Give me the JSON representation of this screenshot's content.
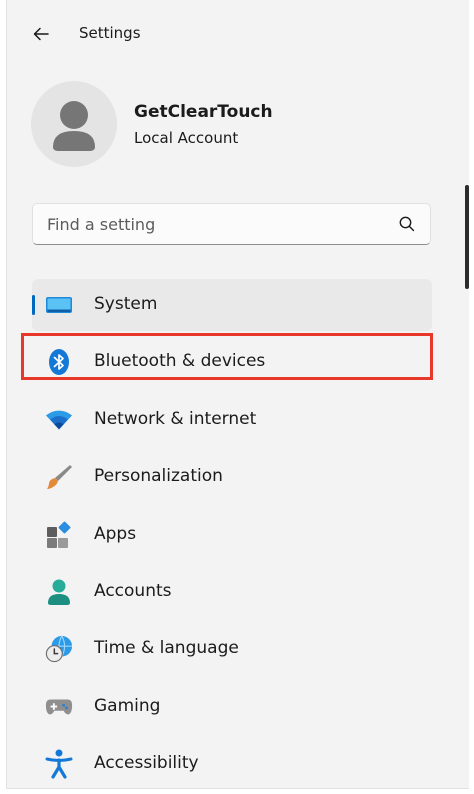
{
  "header": {
    "title": "Settings",
    "back_icon": "back-arrow-icon"
  },
  "profile": {
    "name": "GetClearTouch",
    "account_type": "Local Account",
    "avatar_icon": "user-avatar-icon"
  },
  "search": {
    "placeholder": "Find a setting",
    "value": "",
    "icon": "search-icon"
  },
  "nav": {
    "items": [
      {
        "label": "System",
        "icon": "monitor-icon",
        "selected": true
      },
      {
        "label": "Bluetooth & devices",
        "icon": "bluetooth-icon",
        "selected": false,
        "highlighted": true
      },
      {
        "label": "Network & internet",
        "icon": "wifi-icon",
        "selected": false
      },
      {
        "label": "Personalization",
        "icon": "paintbrush-icon",
        "selected": false
      },
      {
        "label": "Apps",
        "icon": "apps-icon",
        "selected": false
      },
      {
        "label": "Accounts",
        "icon": "person-icon",
        "selected": false
      },
      {
        "label": "Time & language",
        "icon": "globe-clock-icon",
        "selected": false
      },
      {
        "label": "Gaming",
        "icon": "gamepad-icon",
        "selected": false
      },
      {
        "label": "Accessibility",
        "icon": "accessibility-icon",
        "selected": false
      }
    ]
  },
  "colors": {
    "accent": "#0067c0",
    "highlight": "#e8382a",
    "selected_bg": "#e9e9e9",
    "window_bg": "#f3f3f3"
  }
}
